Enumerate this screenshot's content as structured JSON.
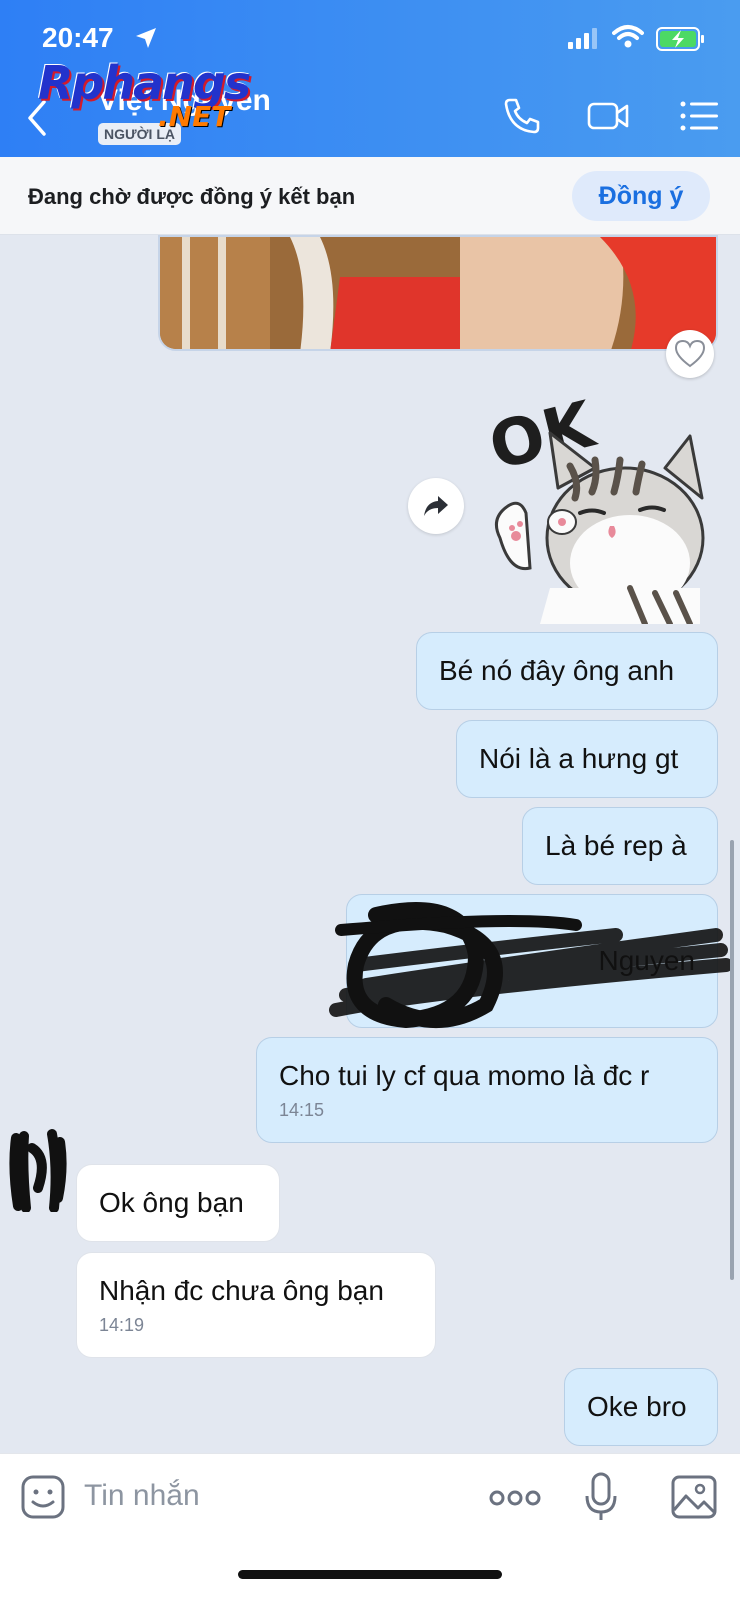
{
  "status_bar": {
    "time": "20:47"
  },
  "header": {
    "title": "Việt Nguyen",
    "badge": "NGƯỜI LẠ",
    "watermark_main": "Rphangs",
    "watermark_sub": ".NET",
    "icons": [
      "back-icon",
      "phone-icon",
      "video-call-icon",
      "menu-icon"
    ]
  },
  "friend_request": {
    "text": "Đang chờ được đồng ý kết bạn",
    "accept_label": "Đồng ý"
  },
  "sticker": {
    "caption": "OK"
  },
  "messages": {
    "m1": {
      "text": "Bé nó đây ông anh"
    },
    "m2": {
      "text": "Nói là a hưng gt"
    },
    "m3": {
      "text": "Là bé rep à"
    },
    "m4": {
      "text": "Nguyen"
    },
    "m5": {
      "text": "Cho tui ly cf qua momo là đc r",
      "time": "14:15"
    },
    "m6": {
      "text": "Ok ông bạn"
    },
    "m7": {
      "text": "Nhận đc chưa ông bạn",
      "time": "14:19"
    },
    "m8": {
      "text": "Oke bro"
    }
  },
  "composer": {
    "placeholder": "Tin nhắn",
    "value": ""
  },
  "colors": {
    "header_start": "#2e7ff5",
    "header_end": "#4a9cf0",
    "my_bubble": "#d6ecfd",
    "their_bubble": "#ffffff",
    "chat_bg": "#e3e8f1",
    "accent": "#1a6fe0"
  }
}
